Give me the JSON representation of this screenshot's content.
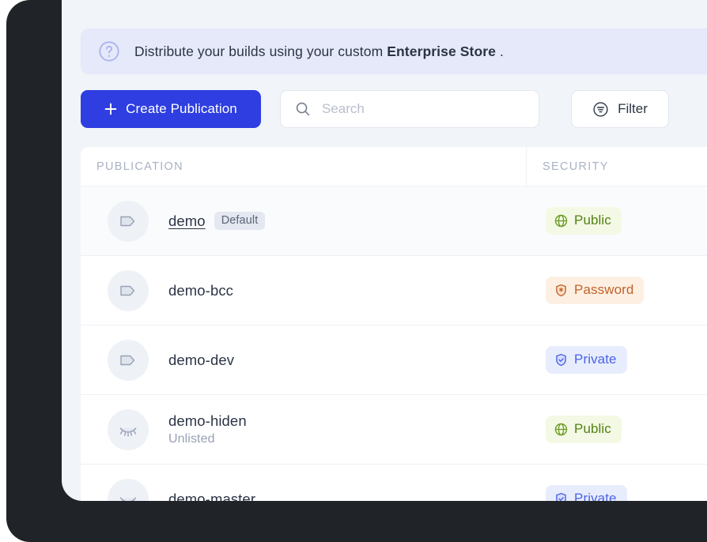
{
  "banner": {
    "icon": "help-circle-icon",
    "text_before": "Distribute your builds using your custom",
    "text_strong": "Enterprise Store",
    "text_after": "."
  },
  "toolbar": {
    "create_label": "Create Publication",
    "create_icon": "plus-icon",
    "search_placeholder": "Search",
    "search_value": "",
    "search_icon": "search-icon",
    "filter_label": "Filter",
    "filter_icon": "filter-icon"
  },
  "table": {
    "columns": [
      "PUBLICATION",
      "SECURITY"
    ],
    "rows": [
      {
        "name": "demo",
        "badge": "Default",
        "subtitle": "",
        "icon": "tag-icon",
        "linked": true,
        "security": "Public",
        "security_icon": "globe-icon"
      },
      {
        "name": "demo-bcc",
        "badge": "",
        "subtitle": "",
        "icon": "tag-icon",
        "linked": false,
        "security": "Password",
        "security_icon": "shield-asterisk-icon"
      },
      {
        "name": "demo-dev",
        "badge": "",
        "subtitle": "",
        "icon": "tag-icon",
        "linked": false,
        "security": "Private",
        "security_icon": "shield-check-icon"
      },
      {
        "name": "demo-hiden",
        "badge": "",
        "subtitle": "Unlisted",
        "icon": "eye-closed-icon",
        "linked": false,
        "security": "Public",
        "security_icon": "globe-icon"
      },
      {
        "name": "demo-master",
        "badge": "",
        "subtitle": "",
        "icon": "eye-closed-icon",
        "linked": false,
        "security": "Private",
        "security_icon": "shield-check-icon"
      }
    ]
  },
  "colors": {
    "accent": "#2e3ee0",
    "frame": "#202429",
    "page_bg": "#f1f4f8",
    "banner_bg": "#e6e9fa",
    "public": "#548014",
    "password": "#c2622a",
    "private": "#4a63e7"
  }
}
